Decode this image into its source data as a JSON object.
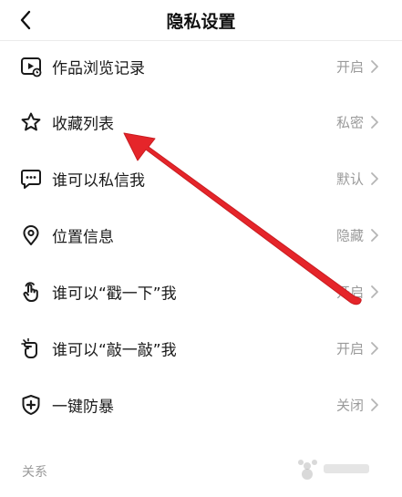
{
  "header": {
    "title": "隐私设置"
  },
  "items": [
    {
      "label": "作品浏览记录",
      "value": "开启"
    },
    {
      "label": "收藏列表",
      "value": "私密"
    },
    {
      "label": "谁可以私信我",
      "value": "默认"
    },
    {
      "label": "位置信息",
      "value": "隐藏"
    },
    {
      "label": "谁可以“戳一下”我",
      "value": "开启"
    },
    {
      "label": "谁可以“敲一敲”我",
      "value": "开启"
    },
    {
      "label": "一键防暴",
      "value": "关闭"
    }
  ],
  "section": {
    "label": "关系"
  },
  "colors": {
    "arrow": "#e5252a",
    "text": "#1a1a1a",
    "secondary": "#9a9a9a"
  },
  "icons": [
    "play-record-icon",
    "star-icon",
    "message-icon",
    "location-pin-icon",
    "tap-hand-icon",
    "knock-hand-icon",
    "shield-plus-icon"
  ]
}
